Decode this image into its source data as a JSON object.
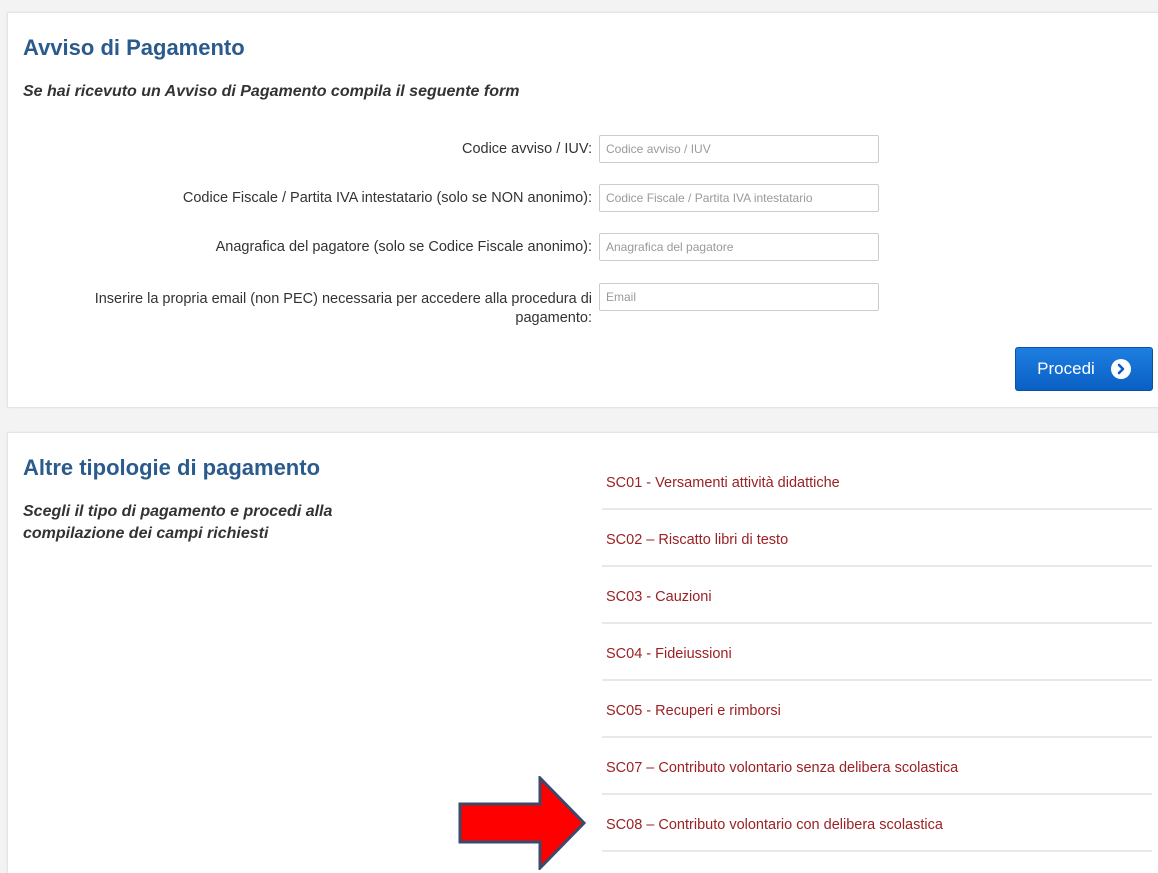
{
  "avviso": {
    "title": "Avviso di Pagamento",
    "subtitle": "Se hai ricevuto un Avviso di Pagamento compila il seguente form",
    "fields": [
      {
        "label": "Codice avviso / IUV:",
        "placeholder": "Codice avviso / IUV",
        "value": ""
      },
      {
        "label": "Codice Fiscale / Partita IVA intestatario (solo se NON anonimo):",
        "placeholder": "Codice Fiscale / Partita IVA intestatario",
        "value": ""
      },
      {
        "label": "Anagrafica del pagatore (solo se Codice Fiscale anonimo):",
        "placeholder": "Anagrafica del pagatore",
        "value": ""
      },
      {
        "label_line1": "Inserire la propria email (non PEC) necessaria per accedere alla procedura di",
        "label_line2": "pagamento:",
        "placeholder": "Email",
        "value": ""
      }
    ],
    "submit_label": "Procedi",
    "submit_icon": "chevron-circle-right-icon"
  },
  "altre": {
    "title": "Altre tipologie di pagamento",
    "subtitle_line1": "Scegli il tipo di pagamento e procedi alla",
    "subtitle_line2": "compilazione dei campi richiesti",
    "items": [
      "SC01 - Versamenti attività didattiche",
      "SC02 – Riscatto libri di testo",
      "SC03 - Cauzioni",
      "SC04 - Fideiussioni",
      "SC05 - Recuperi e rimborsi",
      "SC07 – Contributo volontario senza delibera scolastica",
      "SC08 – Contributo volontario con delibera scolastica"
    ]
  },
  "annotation": {
    "icon": "red-arrow-pointer",
    "fill": "#ff0000",
    "stroke": "#3a4a6b"
  },
  "colors": {
    "title": "#2a5b8c",
    "link": "#9b2124",
    "button": "#0a5fc4"
  }
}
